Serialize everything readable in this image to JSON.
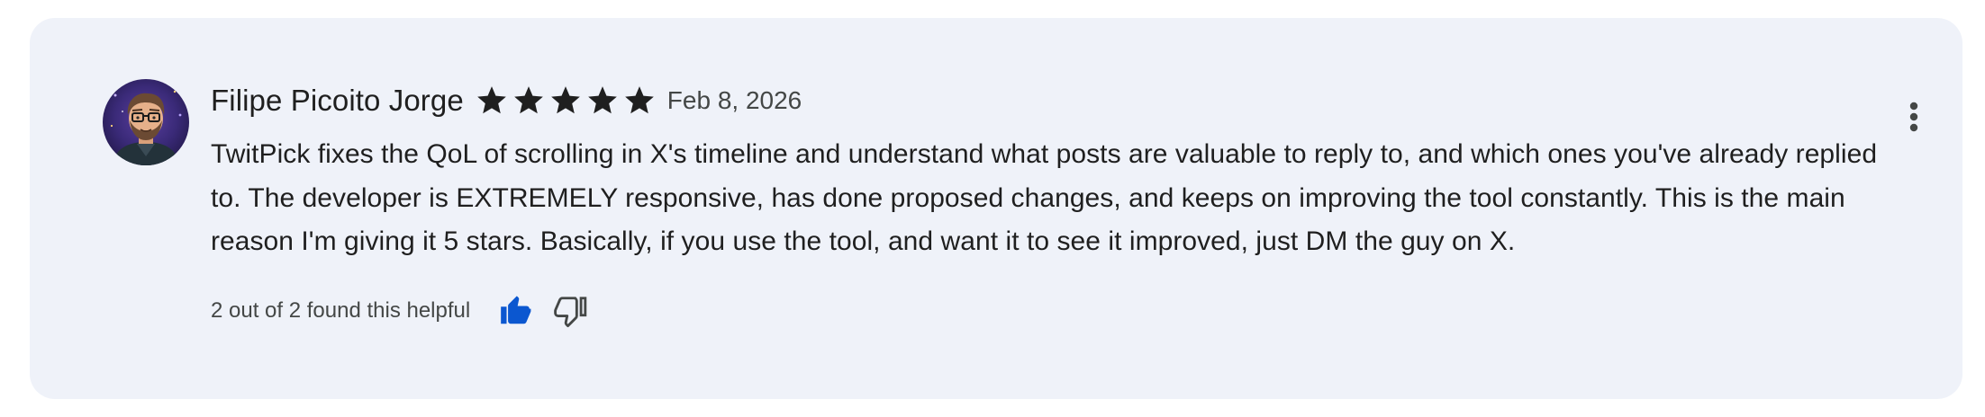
{
  "review": {
    "author": "Filipe Picoito Jorge",
    "rating": 5,
    "rating_max": 5,
    "date": "Feb 8, 2026",
    "text": "TwitPick fixes the QoL of scrolling in X's timeline and understand what posts are valuable to reply to, and which ones you've already replied to. The developer is EXTREMELY responsive, has done proposed changes, and keeps on improving the tool constantly. This is the main reason I'm giving it 5 stars. Basically, if you use the tool, and want it to see it improved, just DM the guy on X.",
    "helpful_text": "2 out of 2 found this helpful"
  },
  "icons": {
    "star": "star-icon",
    "thumbs_up": "thumbs-up-icon",
    "thumbs_down": "thumbs-down-icon",
    "more": "more-vert-icon"
  },
  "colors": {
    "card_background": "#eff2f9",
    "star": "#1f1f1f",
    "thumbs_up_active": "#0b57d0",
    "thumbs_down": "#444746",
    "secondary_text": "#444746"
  }
}
